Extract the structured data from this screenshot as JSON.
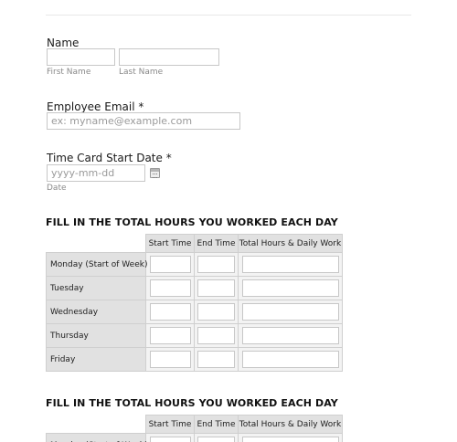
{
  "name": {
    "label": "Name",
    "first_value": "",
    "last_value": "",
    "first_sublabel": "First Name",
    "last_sublabel": "Last Name"
  },
  "email": {
    "label": "Employee Email *",
    "value": "",
    "placeholder": "ex: myname@example.com"
  },
  "start_date": {
    "label": "Time Card Start Date *",
    "value": "",
    "placeholder": "yyyy-mm-dd",
    "sublabel": "Date",
    "icon": "calendar-icon"
  },
  "week1": {
    "heading": "FILL IN THE TOTAL HOURS YOU WORKED EACH DAY",
    "columns": [
      "Start Time",
      "End Time",
      "Total Hours & Daily Work"
    ],
    "rows": [
      "Monday (Start of Week)",
      "Tuesday",
      "Wednesday",
      "Thursday",
      "Friday"
    ]
  },
  "week2": {
    "heading": "FILL IN THE TOTAL HOURS YOU WORKED EACH DAY",
    "columns": [
      "Start Time",
      "End Time",
      "Total Hours & Daily Work"
    ],
    "rows": [
      "Monday (Start of Week)"
    ]
  }
}
